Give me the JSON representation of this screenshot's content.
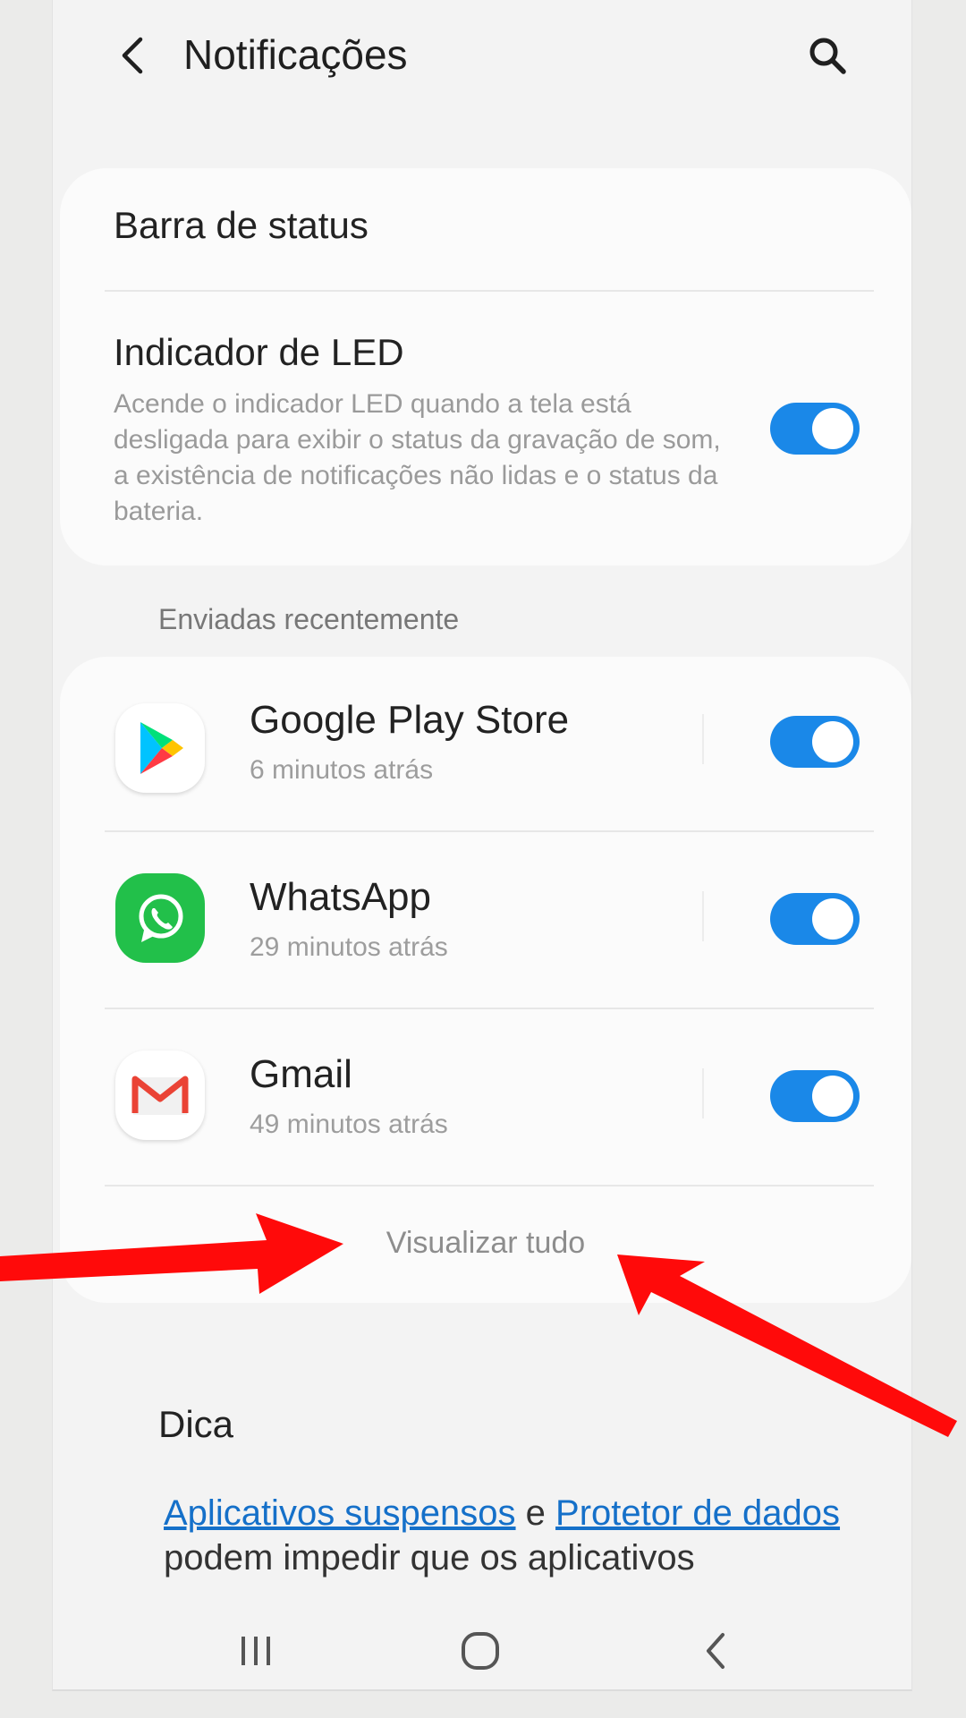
{
  "header": {
    "title": "Notificações"
  },
  "card1": {
    "status_bar_label": "Barra de status",
    "led": {
      "title": "Indicador de LED",
      "description": "Acende o indicador LED quando a tela está desligada para exibir o status da gravação de som, a existência de notificações não lidas e o status da bateria.",
      "enabled": true
    }
  },
  "recent": {
    "section_label": "Enviadas recentemente",
    "apps": [
      {
        "name": "Google Play Store",
        "time": "6 minutos atrás",
        "icon": "google-play-icon",
        "enabled": true
      },
      {
        "name": "WhatsApp",
        "time": "29 minutos atrás",
        "icon": "whatsapp-icon",
        "enabled": true
      },
      {
        "name": "Gmail",
        "time": "49 minutos atrás",
        "icon": "gmail-icon",
        "enabled": true
      }
    ],
    "view_all": "Visualizar tudo"
  },
  "tip": {
    "title": "Dica",
    "link1": "Aplicativos suspensos",
    "conj": " e ",
    "link2": "Protetor de dados",
    "rest": " podem impedir que os aplicativos"
  },
  "colors": {
    "accent": "#1a88e8",
    "annotation_arrow": "#ff0000",
    "link": "#1570c9"
  },
  "nav": {
    "recents_icon": "recents-icon",
    "home_icon": "home-icon",
    "back_icon": "back-icon"
  }
}
